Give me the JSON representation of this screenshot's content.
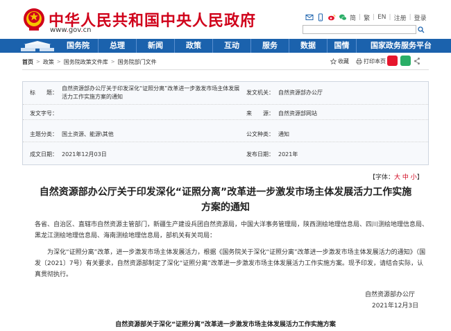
{
  "header": {
    "site_title": "中华人民共和国中央人民政府",
    "site_url_prefix": "www",
    "site_url_dot1": ".",
    "site_url_domain": "gov",
    "site_url_dot2": ".",
    "site_url_suffix": "cn",
    "tools": {
      "simplified": "简",
      "traditional": "繁",
      "english": "EN",
      "login_register": "注册",
      "login": "登录"
    },
    "search": {
      "value": ""
    }
  },
  "nav": {
    "items": [
      {
        "label": "国务院"
      },
      {
        "label": "总理"
      },
      {
        "label": "新闻"
      },
      {
        "label": "政策"
      },
      {
        "label": "互动"
      },
      {
        "label": "服务"
      },
      {
        "label": "数据"
      },
      {
        "label": "国情"
      },
      {
        "label": "国家政务服务平台"
      }
    ]
  },
  "breadcrumb": {
    "home": "首页",
    "items": [
      "政策",
      "国务院政策文件库",
      "国务院部门文件"
    ]
  },
  "actions": {
    "favorite": "收藏",
    "print": "打印本页"
  },
  "info": {
    "title_label": "标　　题：",
    "title_value": "自然资源部办公厅关于印发深化“证照分离”改革进一步激发市场主体发展活力工作实施方案的通知",
    "issuer_label": "发文机关：",
    "issuer_value": "自然资源部办公厅",
    "docno_label": "发文字号：",
    "docno_value": "",
    "source_label": "来　　源：",
    "source_value": "自然资源部网站",
    "topic_label": "主题分类：",
    "topic_value": "国土资源、能源\\其他",
    "type_label": "公文种类：",
    "type_value": "通知",
    "date_label": "成文日期：",
    "date_value": "2021年12月03日",
    "pubdate_label": "发布日期：",
    "pubdate_value": "2021年"
  },
  "fontsize": {
    "open": "【字体：",
    "large": "大",
    "medium": "中",
    "small": "小",
    "close": "】"
  },
  "article": {
    "title_line1": "自然资源部办公厅关于印发深化“证照分离”改革进一步激发市场主体发展活力工作实施",
    "title_line2": "方案的通知",
    "para1": "各省、自治区、直辖市自然资源主管部门，新疆生产建设兵团自然资源局，中国大洋事务管理局，陕西测绘地理信息局、四川测绘地理信息局、黑龙江测绘地理信息局、海南测绘地理信息局，部机关有关司局：",
    "para2": "为深化“证照分离”改革，进一步激发市场主体发展活力，根据《国务院关于深化“证照分离”改革进一步激发市场主体发展活力的通知》（国发〔2021〕7号）有关要求，自然资源部制定了深化“证照分离”改革进一步激发市场主体发展活力工作实施方案。现予印发，请结合实际，认真贯彻执行。",
    "signer": "自然资源部办公厅",
    "sign_date": "2021年12月3日",
    "sub_title": "自然资源部关于深化“证照分离”改革进一步激发市场主体发展活力工作实施方案"
  },
  "colors": {
    "brand_red": "#d0021b",
    "nav_blue": "#1b62ad"
  }
}
